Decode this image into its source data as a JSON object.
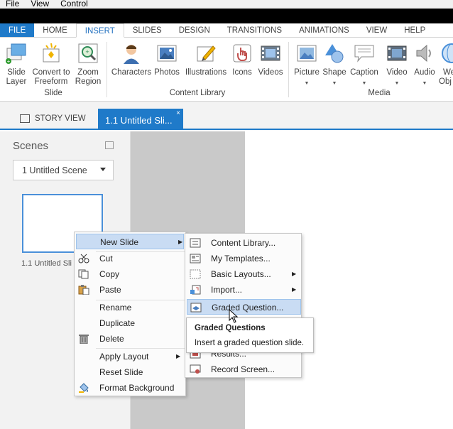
{
  "menubar": {
    "items": [
      "File",
      "View",
      "Control"
    ]
  },
  "ribbon_tabs": [
    {
      "label": "FILE",
      "kind": "file"
    },
    {
      "label": "HOME",
      "kind": "normal"
    },
    {
      "label": "INSERT",
      "kind": "active"
    },
    {
      "label": "SLIDES",
      "kind": "normal"
    },
    {
      "label": "DESIGN",
      "kind": "normal"
    },
    {
      "label": "TRANSITIONS",
      "kind": "normal"
    },
    {
      "label": "ANIMATIONS",
      "kind": "normal"
    },
    {
      "label": "VIEW",
      "kind": "normal"
    },
    {
      "label": "HELP",
      "kind": "normal"
    }
  ],
  "ribbon": {
    "slide_group": {
      "label": "Slide",
      "buttons": [
        {
          "line1": "Slide",
          "line2": "Layer",
          "icon": "slide-layer-icon"
        },
        {
          "line1": "Convert to",
          "line2": "Freeform",
          "icon": "freeform-icon"
        },
        {
          "line1": "Zoom",
          "line2": "Region",
          "icon": "zoom-region-icon"
        }
      ]
    },
    "content_group": {
      "label": "Content Library",
      "buttons": [
        {
          "line1": "Characters",
          "icon": "character-icon"
        },
        {
          "line1": "Photos",
          "icon": "photo-icon"
        },
        {
          "line1": "Illustrations",
          "icon": "illustration-icon"
        },
        {
          "line1": "Icons",
          "icon": "hand-icon"
        },
        {
          "line1": "Videos",
          "icon": "film-icon"
        }
      ]
    },
    "media_group": {
      "label": "Media",
      "buttons": [
        {
          "line1": "Picture",
          "icon": "picture-icon"
        },
        {
          "line1": "Shape",
          "icon": "shape-icon"
        },
        {
          "line1": "Caption",
          "icon": "caption-icon"
        },
        {
          "line1": "Video",
          "icon": "video-icon"
        },
        {
          "line1": "Audio",
          "icon": "speaker-icon"
        },
        {
          "line1": "We",
          "line2": "Obj",
          "icon": "web-object-icon"
        }
      ]
    }
  },
  "doc_tabs": {
    "story_view": "STORY VIEW",
    "slide_tab": "1.1 Untitled Sli...",
    "close": "×"
  },
  "scenes": {
    "title": "Scenes",
    "selected_scene": "1 Untitled Scene",
    "thumb_label": "1.1 Untitled Sli"
  },
  "context_menu": {
    "items": [
      {
        "label": "New Slide",
        "has_submenu": true,
        "highlighted": true
      },
      {
        "label": "Cut",
        "icon": "scissors-icon"
      },
      {
        "label": "Copy",
        "icon": "copy-icon"
      },
      {
        "label": "Paste",
        "icon": "paste-icon"
      },
      {
        "label": "Rename"
      },
      {
        "label": "Duplicate"
      },
      {
        "label": "Delete",
        "icon": "trash-icon"
      },
      {
        "label": "Apply Layout",
        "has_submenu": true
      },
      {
        "label": "Reset Slide"
      },
      {
        "label": "Format Background",
        "icon": "paint-bucket-icon"
      }
    ]
  },
  "submenu": {
    "items": [
      {
        "label": "Content Library...",
        "icon": "library-icon"
      },
      {
        "label": "My Templates...",
        "icon": "templates-icon"
      },
      {
        "label": "Basic Layouts...",
        "icon": "layouts-icon",
        "has_submenu": true
      },
      {
        "label": "Import...",
        "icon": "import-icon",
        "has_submenu": true
      },
      {
        "label": "Graded Question...",
        "icon": "graded-question-icon",
        "highlighted": true
      },
      {
        "label": "Results...",
        "icon": "results-icon"
      },
      {
        "label": "Record Screen...",
        "icon": "record-screen-icon"
      }
    ]
  },
  "tooltip": {
    "title": "Graded Questions",
    "body": "Insert a graded question slide."
  },
  "colors": {
    "accent": "#1f7ac9",
    "menu_highlight": "#c9dcf3",
    "panel": "#f2f2f2",
    "gutter": "#c9c9c9"
  }
}
